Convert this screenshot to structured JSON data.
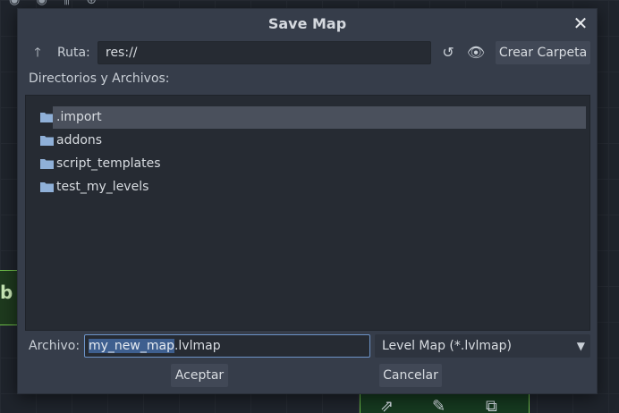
{
  "dialog": {
    "title": "Save Map",
    "path_label": "Ruta:",
    "path_value": "res://",
    "create_folder_label": "Crear Carpeta",
    "section_label": "Directorios y Archivos:",
    "files": [
      {
        "name": ".import",
        "type": "folder",
        "selected": true
      },
      {
        "name": "addons",
        "type": "folder",
        "selected": false
      },
      {
        "name": "script_templates",
        "type": "folder",
        "selected": false
      },
      {
        "name": "test_my_levels",
        "type": "folder",
        "selected": false
      }
    ],
    "filename_label": "Archivo:",
    "filename_selected_part": "my_new_map",
    "filename_rest": ".lvlmap",
    "filter_value": "Level Map (*.lvlmap)",
    "ok_label": "Aceptar",
    "cancel_label": "Cancelar"
  },
  "icons": {
    "close": "close-icon",
    "up": "arrow-up-icon",
    "refresh": "refresh-icon",
    "hidden": "eye-icon",
    "folder": "folder-icon",
    "dropdown": "chevron-down-icon"
  },
  "colors": {
    "dialog_bg": "#363d4a",
    "list_bg": "#262b33",
    "selection": "#4a505c",
    "folder": "#8fb0d8",
    "focus_border": "#6c93c7"
  }
}
